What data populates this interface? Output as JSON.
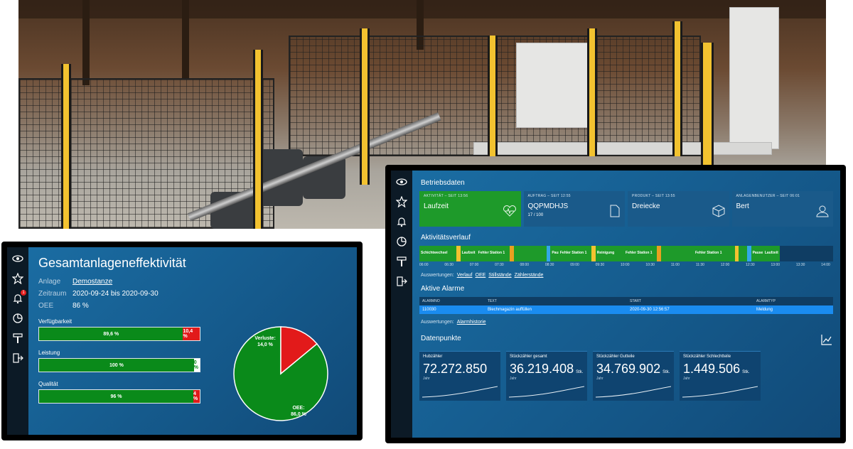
{
  "colors": {
    "accent_green": "#0a8a1a",
    "alert_red": "#e21a1a",
    "screen_blue": "#165e91",
    "sidebar_dark": "#0c1a26",
    "highlight_blue": "#1a8cf0"
  },
  "sidebar": {
    "icons": [
      "eye-icon",
      "star-icon",
      "bell-icon",
      "pie-chart-icon",
      "hammer-icon",
      "logout-icon"
    ],
    "bell_badge": "1"
  },
  "oee_panel": {
    "title": "Gesamtanlageneffektivität",
    "anlage_label": "Anlage",
    "anlage_value": "Demostanze",
    "zeitraum_label": "Zeitraum",
    "zeitraum_value": "2020-09-24 bis 2020-09-30",
    "oee_label": "OEE",
    "oee_value": "86 %",
    "bars": [
      {
        "label": "Verfügbarkeit",
        "good": 89.6,
        "good_text": "89,6 %",
        "bad_text": "10,4 %"
      },
      {
        "label": "Leistung",
        "good": 100,
        "good_text": "100 %",
        "bad_text": "0 %"
      },
      {
        "label": "Qualität",
        "good": 96,
        "good_text": "96 %",
        "bad_text": "4 %"
      }
    ],
    "pie": {
      "loss_label": "Verluste:",
      "loss_value": "14,0 %",
      "oee_label": "OEE:",
      "oee_value": "86,0 %",
      "loss_fraction": 0.14
    }
  },
  "betrieb_panel": {
    "title": "Betriebsdaten",
    "cards": [
      {
        "label": "AKTIVITÄT – SEIT 13:56",
        "value": "Laufzeit",
        "sub": "",
        "icon": "heartbeat-icon",
        "active": true
      },
      {
        "label": "AUFTRAG – SEIT 12:55",
        "value": "QQPMDHJS",
        "sub": "17 / 100",
        "icon": "document-icon",
        "active": false
      },
      {
        "label": "PRODUKT – SEIT 13:55",
        "value": "Dreiecke",
        "sub": "",
        "icon": "cube-icon",
        "active": false
      },
      {
        "label": "ANLAGENBENUTZER – SEIT 06:01",
        "value": "Bert",
        "sub": "",
        "icon": "user-icon",
        "active": false
      }
    ],
    "verlauf_title": "Aktivitätsverlauf",
    "timeline": [
      {
        "label": "Schichtwechsel",
        "w": 9,
        "c": "#1e9a2a"
      },
      {
        "label": "",
        "w": 1,
        "c": "#f2c230"
      },
      {
        "label": "Laufzeit",
        "w": 4,
        "c": "#1e9a2a"
      },
      {
        "label": "Fehler Station 1",
        "w": 8,
        "c": "#1e9a2a"
      },
      {
        "label": "",
        "w": 1,
        "c": "#e8a020"
      },
      {
        "label": "",
        "w": 8,
        "c": "#1e9a2a"
      },
      {
        "label": "",
        "w": 1,
        "c": "#33a7e8"
      },
      {
        "label": "Pause",
        "w": 2,
        "c": "#1e9a2a"
      },
      {
        "label": "Fehler Station 1",
        "w": 8,
        "c": "#1e9a2a"
      },
      {
        "label": "",
        "w": 1,
        "c": "#f2c230"
      },
      {
        "label": "Reinigung",
        "w": 7,
        "c": "#1e9a2a"
      },
      {
        "label": "Fehler Station 1",
        "w": 8,
        "c": "#1e9a2a"
      },
      {
        "label": "",
        "w": 1,
        "c": "#e8a020"
      },
      {
        "label": "",
        "w": 8,
        "c": "#1e9a2a"
      },
      {
        "label": "Fehler Station 1",
        "w": 10,
        "c": "#1e9a2a"
      },
      {
        "label": "",
        "w": 1,
        "c": "#f2c230"
      },
      {
        "label": "",
        "w": 2,
        "c": "#1e9a2a"
      },
      {
        "label": "",
        "w": 1,
        "c": "#33a7e8"
      },
      {
        "label": "Pause",
        "w": 3,
        "c": "#1e9a2a"
      },
      {
        "label": "Laufzeit",
        "w": 4,
        "c": "#1e9a2a"
      },
      {
        "label": "",
        "w": 13,
        "c": "#0f3d63"
      }
    ],
    "ticks": [
      "06:00",
      "06:30",
      "07:00",
      "07:30",
      "08:00",
      "08:30",
      "09:00",
      "09:30",
      "10:00",
      "10:30",
      "11:00",
      "11:30",
      "12:00",
      "12:30",
      "13:00",
      "13:30",
      "14:00"
    ],
    "auswertungen_label": "Auswertungen:",
    "auswertungen_links": [
      "Verlauf",
      "OEE",
      "Stillstände",
      "Zählerstände"
    ],
    "alarme_title": "Aktive Alarme",
    "alarm_headers": [
      "ALARMNO",
      "TEXT",
      "START",
      "ALARMTYP"
    ],
    "alarm_rows": [
      [
        "110030",
        "Blechmagazin auffüllen",
        "2020-09-30 12:56:57",
        "Meldung"
      ]
    ],
    "alarm_links_label": "Auswertungen:",
    "alarm_links": [
      "Alarmhistorie"
    ],
    "datenpunkte_title": "Datenpunkte",
    "datapoints": [
      {
        "title": "Hubzähler",
        "value": "72.272.850",
        "unit": "",
        "sub": "Jahr"
      },
      {
        "title": "Stückzähler gesamt",
        "value": "36.219.408",
        "unit": "Stk.",
        "sub": "Jahr"
      },
      {
        "title": "Stückzähler Gutteile",
        "value": "34.769.902",
        "unit": "Stk.",
        "sub": "Jahr"
      },
      {
        "title": "Stückzähler Schlechtteile",
        "value": "1.449.506",
        "unit": "Stk.",
        "sub": "Jahr"
      }
    ]
  }
}
